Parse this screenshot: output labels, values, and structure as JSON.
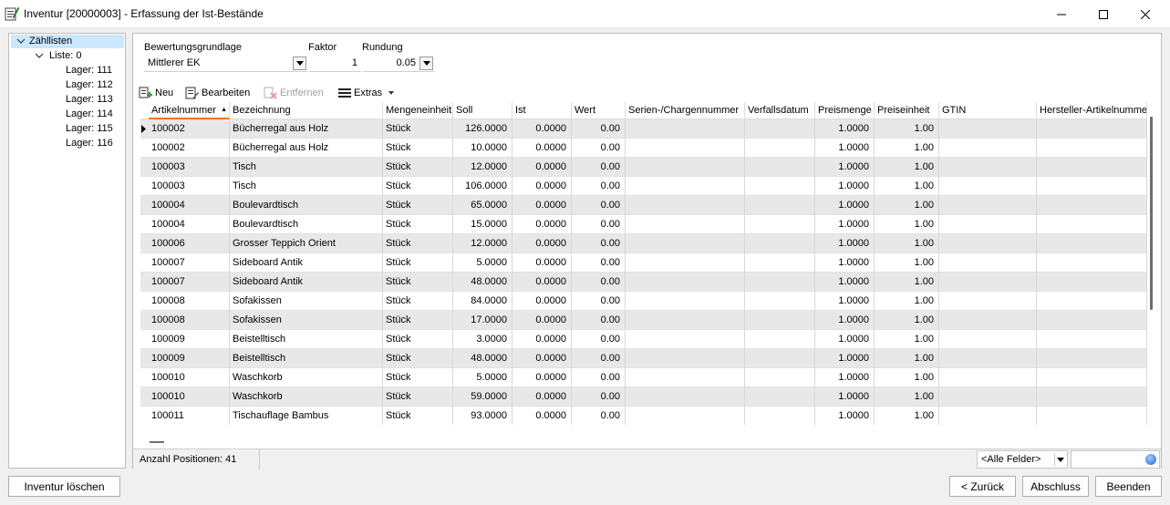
{
  "window": {
    "title": "Inventur [20000003] - Erfassung der Ist-Bestände"
  },
  "tree": {
    "root_label": "Zähllisten",
    "list_label": "Liste: 0",
    "lagers": [
      "Lager: 111",
      "Lager: 112",
      "Lager: 113",
      "Lager: 114",
      "Lager: 115",
      "Lager: 116"
    ]
  },
  "form": {
    "bewertung_label": "Bewertungsgrundlage",
    "bewertung_value": "Mittlerer EK",
    "faktor_label": "Faktor",
    "faktor_value": "1",
    "rundung_label": "Rundung",
    "rundung_value": "0.05"
  },
  "toolbar": {
    "neu": "Neu",
    "bearbeiten": "Bearbeiten",
    "entfernen": "Entfernen",
    "extras": "Extras"
  },
  "grid": {
    "columns": [
      "Artikelnummer",
      "Bezeichnung",
      "Mengeneinheit",
      "Soll",
      "Ist",
      "Wert",
      "Serien-/Chargennummer",
      "Verfallsdatum",
      "Preismenge",
      "Preiseinheit",
      "GTIN",
      "Hersteller-Artikelnummer"
    ],
    "rows": [
      {
        "art": "100002",
        "bez": "Bücherregal aus Holz",
        "me": "Stück",
        "soll": "126.0000",
        "ist": "0.0000",
        "wert": "0.00",
        "pm": "1.0000",
        "pe": "1.00"
      },
      {
        "art": "100002",
        "bez": "Bücherregal aus Holz",
        "me": "Stück",
        "soll": "10.0000",
        "ist": "0.0000",
        "wert": "0.00",
        "pm": "1.0000",
        "pe": "1.00"
      },
      {
        "art": "100003",
        "bez": "Tisch",
        "me": "Stück",
        "soll": "12.0000",
        "ist": "0.0000",
        "wert": "0.00",
        "pm": "1.0000",
        "pe": "1.00"
      },
      {
        "art": "100003",
        "bez": "Tisch",
        "me": "Stück",
        "soll": "106.0000",
        "ist": "0.0000",
        "wert": "0.00",
        "pm": "1.0000",
        "pe": "1.00"
      },
      {
        "art": "100004",
        "bez": "Boulevardtisch",
        "me": "Stück",
        "soll": "65.0000",
        "ist": "0.0000",
        "wert": "0.00",
        "pm": "1.0000",
        "pe": "1.00"
      },
      {
        "art": "100004",
        "bez": "Boulevardtisch",
        "me": "Stück",
        "soll": "15.0000",
        "ist": "0.0000",
        "wert": "0.00",
        "pm": "1.0000",
        "pe": "1.00"
      },
      {
        "art": "100006",
        "bez": "Grosser Teppich Orient",
        "me": "Stück",
        "soll": "12.0000",
        "ist": "0.0000",
        "wert": "0.00",
        "pm": "1.0000",
        "pe": "1.00"
      },
      {
        "art": "100007",
        "bez": "Sideboard Antik",
        "me": "Stück",
        "soll": "5.0000",
        "ist": "0.0000",
        "wert": "0.00",
        "pm": "1.0000",
        "pe": "1.00"
      },
      {
        "art": "100007",
        "bez": "Sideboard Antik",
        "me": "Stück",
        "soll": "48.0000",
        "ist": "0.0000",
        "wert": "0.00",
        "pm": "1.0000",
        "pe": "1.00"
      },
      {
        "art": "100008",
        "bez": "Sofakissen",
        "me": "Stück",
        "soll": "84.0000",
        "ist": "0.0000",
        "wert": "0.00",
        "pm": "1.0000",
        "pe": "1.00"
      },
      {
        "art": "100008",
        "bez": "Sofakissen",
        "me": "Stück",
        "soll": "17.0000",
        "ist": "0.0000",
        "wert": "0.00",
        "pm": "1.0000",
        "pe": "1.00"
      },
      {
        "art": "100009",
        "bez": "Beistelltisch",
        "me": "Stück",
        "soll": "3.0000",
        "ist": "0.0000",
        "wert": "0.00",
        "pm": "1.0000",
        "pe": "1.00"
      },
      {
        "art": "100009",
        "bez": "Beistelltisch",
        "me": "Stück",
        "soll": "48.0000",
        "ist": "0.0000",
        "wert": "0.00",
        "pm": "1.0000",
        "pe": "1.00"
      },
      {
        "art": "100010",
        "bez": "Waschkorb",
        "me": "Stück",
        "soll": "5.0000",
        "ist": "0.0000",
        "wert": "0.00",
        "pm": "1.0000",
        "pe": "1.00"
      },
      {
        "art": "100010",
        "bez": "Waschkorb",
        "me": "Stück",
        "soll": "59.0000",
        "ist": "0.0000",
        "wert": "0.00",
        "pm": "1.0000",
        "pe": "1.00"
      },
      {
        "art": "100011",
        "bez": "Tischauflage Bambus",
        "me": "Stück",
        "soll": "93.0000",
        "ist": "0.0000",
        "wert": "0.00",
        "pm": "1.0000",
        "pe": "1.00"
      }
    ]
  },
  "status": {
    "count_text": "Anzahl Positionen: 41",
    "field_filter": "<Alle Felder>"
  },
  "buttons": {
    "delete": "Inventur löschen",
    "back": "< Zurück",
    "finish": "Abschluss",
    "close": "Beenden"
  },
  "colors": {
    "selection": "#cce8ff",
    "sort_indicator": "#f0731f",
    "alt_row": "#e8e8e8"
  }
}
